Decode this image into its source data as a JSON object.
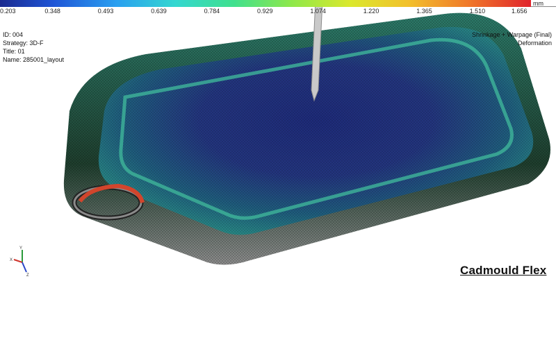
{
  "legend": {
    "unit": "mm",
    "ticks": [
      "0.203",
      "0.348",
      "0.493",
      "0.639",
      "0.784",
      "0.929",
      "1.074",
      "1.220",
      "1.365",
      "1.510",
      "1.656"
    ]
  },
  "info": {
    "id": "ID: 004",
    "strategy": "Strategy: 3D-F",
    "title": "Title: 01",
    "name": "Name: 285001_layout"
  },
  "result": {
    "line1": "Shrinkage + Warpage (Final)",
    "line2": "Deformation"
  },
  "brand": "Cadmould Flex",
  "axes": {
    "x": "X",
    "y": "Y",
    "z": "Z"
  }
}
